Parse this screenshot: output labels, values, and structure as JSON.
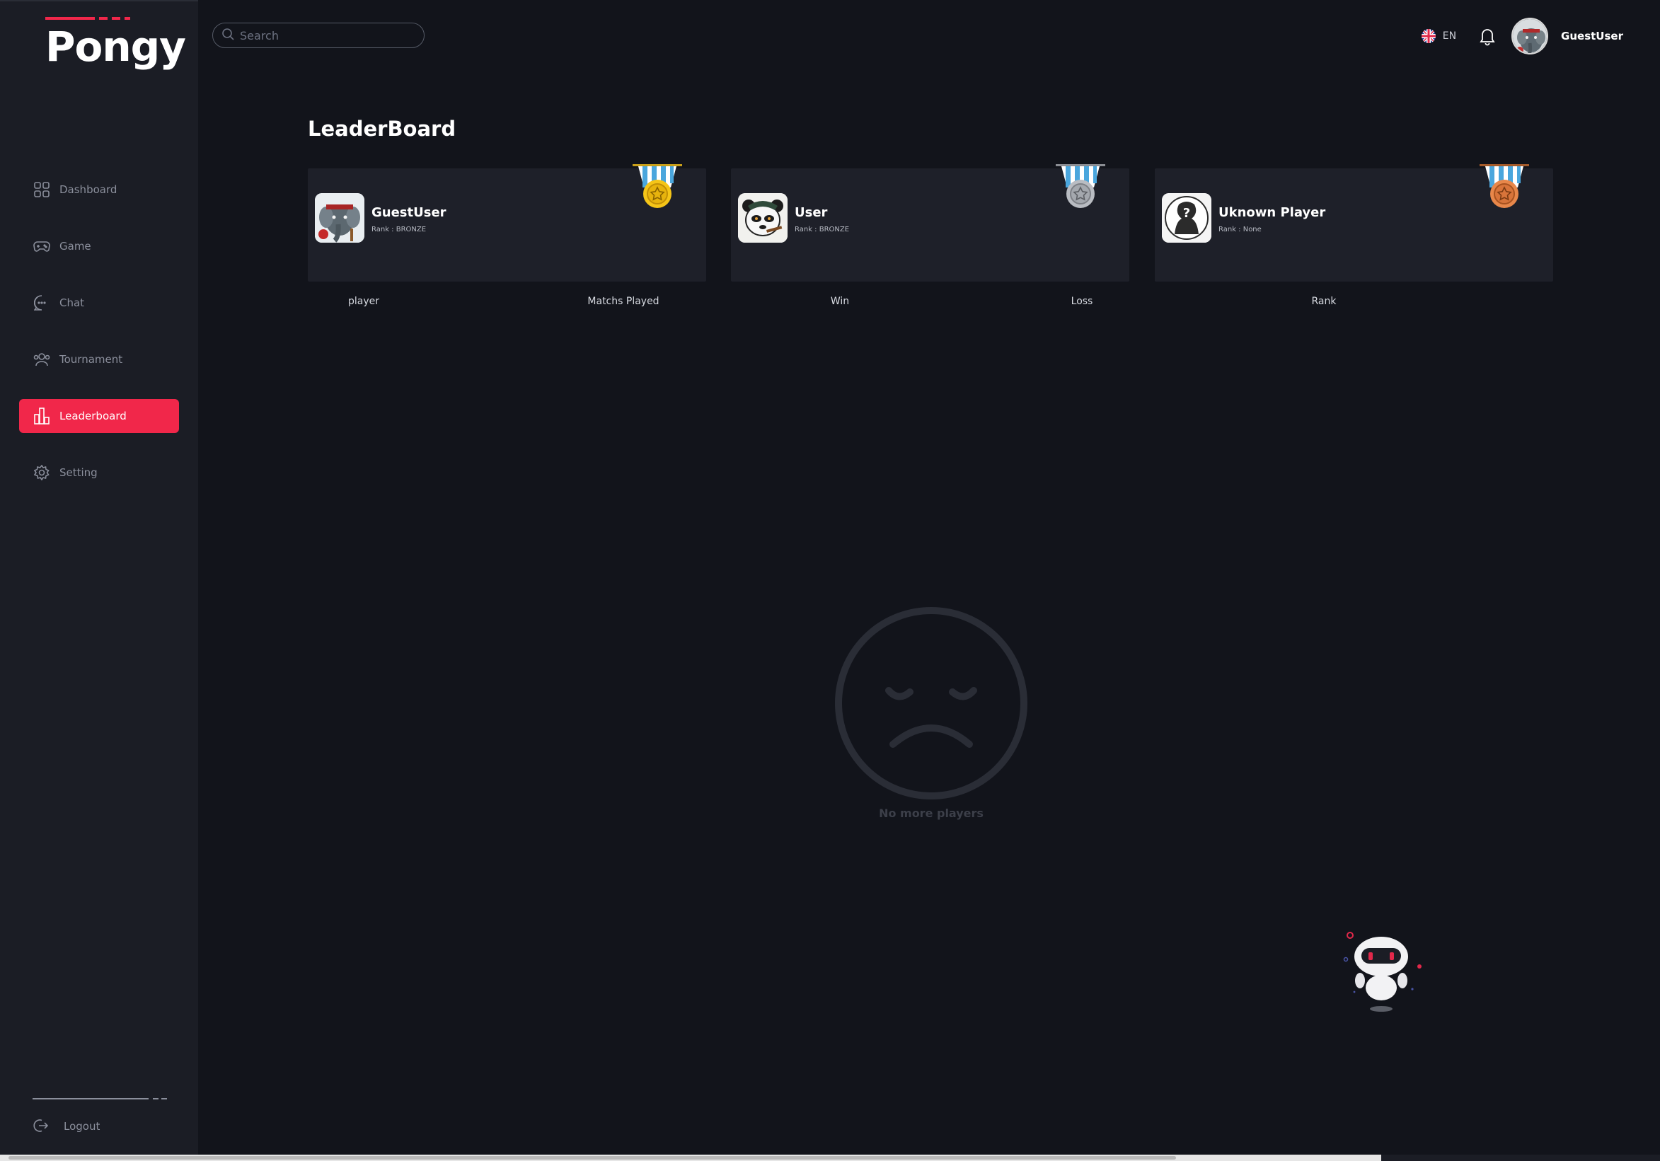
{
  "app": {
    "logo_text": "Pongy",
    "brand_color": "#f1274a"
  },
  "sidebar": {
    "items": [
      {
        "label": "Dashboard",
        "icon": "dashboard-grid-icon",
        "active": false
      },
      {
        "label": "Game",
        "icon": "gamepad-icon",
        "active": false
      },
      {
        "label": "Chat",
        "icon": "chat-bubble-icon",
        "active": false
      },
      {
        "label": "Tournament",
        "icon": "users-group-icon",
        "active": false
      },
      {
        "label": "Leaderboard",
        "icon": "bar-chart-icon",
        "active": true
      },
      {
        "label": "Setting",
        "icon": "gear-icon",
        "active": false
      }
    ],
    "logout_label": "Logout"
  },
  "topbar": {
    "search_placeholder": "Search",
    "language": "EN",
    "username": "GuestUser"
  },
  "main": {
    "title": "LeaderBoard",
    "podium": [
      {
        "name": "GuestUser",
        "rank": "Rank : BRONZE",
        "medal": "gold",
        "medal_color": "#f5c518",
        "avatar": "elephant-avatar"
      },
      {
        "name": "User",
        "rank": "Rank : BRONZE",
        "medal": "silver",
        "medal_color": "#a9acb3",
        "avatar": "panda-avatar"
      },
      {
        "name": "Uknown Player",
        "rank": "Rank : None",
        "medal": "bronze",
        "medal_color": "#e07b3f",
        "avatar": "unknown-avatar"
      }
    ],
    "columns": [
      "player",
      "Matchs Played",
      "Win",
      "Loss",
      "Rank"
    ],
    "empty_text": "No more players"
  }
}
